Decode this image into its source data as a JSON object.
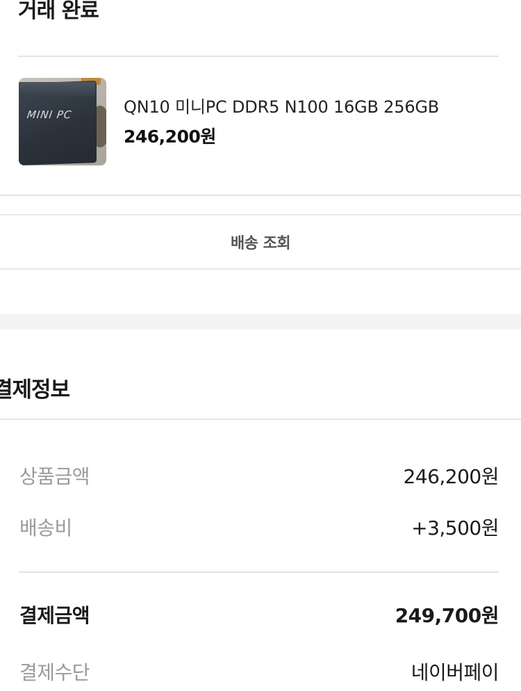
{
  "order": {
    "status_title": "거래 완료",
    "product": {
      "thumbnail_text": "MINI PC",
      "name": "QN10 미니PC DDR5 N100 16GB 256GB",
      "price": "246,200원"
    },
    "tracking_button_label": "배송 조회"
  },
  "payment": {
    "section_title": "결제정보",
    "rows": [
      {
        "label": "상품금액",
        "value": "246,200원"
      },
      {
        "label": "배송비",
        "value": "+3,500원"
      }
    ],
    "total": {
      "label": "결제금액",
      "value": "249,700원"
    },
    "method": {
      "label": "결제수단",
      "value": "네이버페이"
    }
  }
}
